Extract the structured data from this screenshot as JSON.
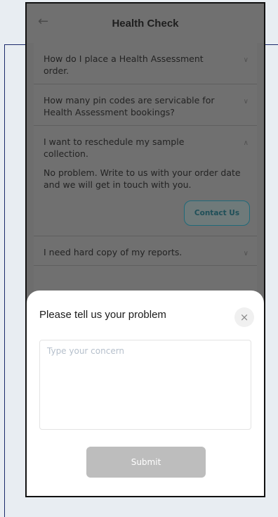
{
  "header": {
    "title": "Health Check",
    "back_icon": "arrow-left-icon"
  },
  "faqs": [
    {
      "question": "How do I place a Health Assessment order."
    },
    {
      "question": "How many pin codes are servicable for Health Assessment bookings?"
    },
    {
      "question": "I want to reschedule my sample collection.",
      "answer": "No problem. Write to us with your order date and we will get in touch with you.",
      "button": "Contact Us"
    },
    {
      "question": "I need hard copy of my reports."
    }
  ],
  "sheet": {
    "title": "Please tell us your problem",
    "placeholder": "Type your concern",
    "submit_label": "Submit"
  },
  "colors": {
    "accent": "#1f6a7a",
    "disabled_button": "#bdbdbd",
    "overlay": "#6d6d6d"
  }
}
